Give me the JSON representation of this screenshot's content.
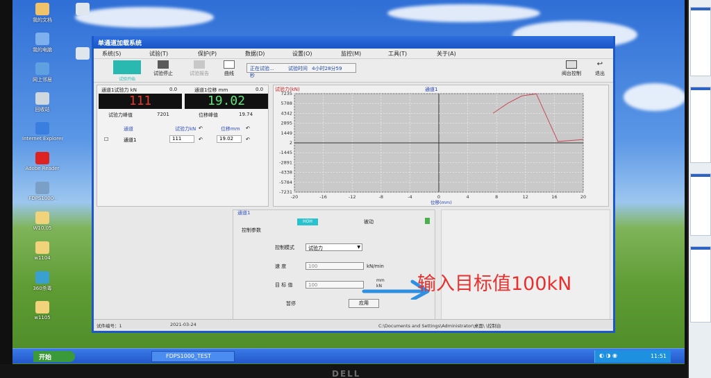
{
  "colors": {
    "titlebar": "#1c58c9",
    "lcd_force": "#e23a2a",
    "lcd_disp": "#61e27c",
    "curve": "#c84a5a",
    "annotation": "#e8302e",
    "arrow": "#2f8fe0"
  },
  "desktop_icons": [
    {
      "label": "我的文档",
      "icon": "documents-icon"
    },
    {
      "label": "我的电脑",
      "icon": "computer-icon"
    },
    {
      "label": "网上邻居",
      "icon": "network-icon"
    },
    {
      "label": "回收站",
      "icon": "recycle-bin-icon"
    },
    {
      "label": "Internet Explorer",
      "icon": "ie-icon"
    },
    {
      "label": "Adobe Reader",
      "icon": "pdf-icon"
    },
    {
      "label": "FDPS1000_",
      "icon": "app-icon"
    },
    {
      "label": "W10.05",
      "icon": "folder-icon"
    },
    {
      "label": "w1104",
      "icon": "folder-icon"
    },
    {
      "label": "360杀毒",
      "icon": "antivirus-icon"
    },
    {
      "label": "w1105",
      "icon": "folder-icon"
    }
  ],
  "app": {
    "title": "单通道加载系统",
    "menus": [
      "系统(S)",
      "试验(T)",
      "保护(P)",
      "数据(D)",
      "设置(O)",
      "监控(M)",
      "工具(T)",
      "关于(A)"
    ],
    "toolbar": {
      "start_label": "试验开始",
      "stop_label": "试验停止",
      "report_label": "试验报告",
      "curve_label": "曲线",
      "status": "正在试验...",
      "time_label": "试验时间",
      "time_value": "4小时28分59秒",
      "remote_label": "阀台控制",
      "exit_label": "退出"
    },
    "left": {
      "force_label": "通道1试验力 kN",
      "force_zero": "0.0",
      "disp_label": "通道1位移 mm",
      "disp_zero": "0.0",
      "force_value": "111",
      "disp_value": "19.02",
      "force_peak_label": "试验力峰值",
      "force_peak": "7201",
      "disp_peak_label": "位移峰值",
      "disp_peak": "19.74",
      "table": {
        "headers": [
          "通道",
          "试验力kN",
          "位移mm"
        ],
        "row": {
          "channel": "通道1",
          "force": "111",
          "disp": "19.02"
        }
      }
    },
    "control": {
      "channel": "通道1",
      "hold_label": "HOH",
      "mode_tab": "被动",
      "section_title": "控制参数",
      "mode_label": "控制模式",
      "mode_value": "试验力",
      "speed_label": "速 度",
      "speed_value": "100",
      "speed_unit": "kN/min",
      "target_label": "目 标 值",
      "target_value": "100",
      "target_unit_top": "mm",
      "target_unit_bottom": "kN",
      "pause_label": "暂停",
      "apply_label": "应用"
    },
    "statusbar": {
      "specimen": "试件编号：1",
      "date": "2021-03-24",
      "path": "C:\\Documents and Settings\\Administrator\\桌面\\ \\控制台"
    }
  },
  "taskbar": {
    "start": "开始",
    "task": "FDPS1000_TEST",
    "clock": "11:51"
  },
  "annotation": {
    "text": "输入目标值100kN"
  },
  "chart_data": {
    "type": "line",
    "title": "通道1",
    "ylabel": "试验力(kN)",
    "xlabel": "位移(mm)",
    "xlim": [
      -20,
      20
    ],
    "ylim": [
      -7231,
      7235
    ],
    "x_ticks": [
      "-20",
      "-16",
      "-12",
      "-8",
      "-4",
      "0",
      "4",
      "8",
      "12",
      "16",
      "20"
    ],
    "y_ticks": [
      "7235",
      "5788",
      "4342",
      "2895",
      "1449",
      "2",
      "-1445",
      "-2891",
      "-4338",
      "-5784",
      "-7231"
    ],
    "grid": true,
    "series": [
      {
        "x": [
          7.5,
          9.5,
          11.5,
          13.5,
          16.5,
          20.5
        ],
        "y": [
          4342,
          5788,
          6900,
          7201,
          200,
          500
        ]
      }
    ]
  }
}
